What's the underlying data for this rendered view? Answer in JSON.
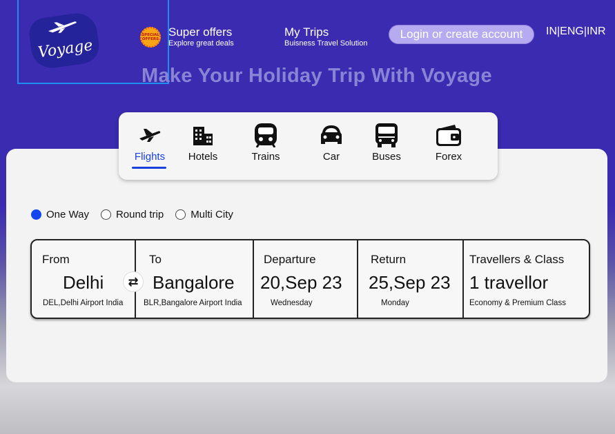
{
  "brand": {
    "logo_text": "Voyage",
    "badge_text": "SPECIAL OFFERS"
  },
  "nav": {
    "offers": {
      "title": "Super offers",
      "subtitle": "Explore great deals"
    },
    "trips": {
      "title": "My Trips",
      "subtitle": "Buisness Travel Solution"
    },
    "login_label": "Login or create account",
    "locale": "IN|ENG|INR"
  },
  "hero": {
    "title": "Make Your Holiday Trip With Voyage"
  },
  "tabs": [
    {
      "label": "Flights",
      "icon": "airplane-icon",
      "active": true
    },
    {
      "label": "Hotels",
      "icon": "hotel-icon"
    },
    {
      "label": "Trains",
      "icon": "train-icon"
    },
    {
      "label": "Car",
      "icon": "car-icon"
    },
    {
      "label": "Buses",
      "icon": "bus-icon"
    },
    {
      "label": "Forex",
      "icon": "wallet-icon"
    }
  ],
  "trip_types": [
    {
      "label": "One Way",
      "selected": true
    },
    {
      "label": "Round trip",
      "selected": false
    },
    {
      "label": "Multi City",
      "selected": false
    }
  ],
  "search": {
    "from": {
      "label": "From",
      "city": "Delhi",
      "airport": "DEL,Delhi Airport India"
    },
    "to": {
      "label": "To",
      "city": "Bangalore",
      "airport": "BLR,Bangalore Airport India"
    },
    "departure": {
      "label": "Departure",
      "date": "20,Sep 23",
      "day": "Wednesday"
    },
    "return": {
      "label": "Return",
      "date": "25,Sep 23",
      "day": "Monday"
    },
    "travellers": {
      "label": "Travellers & Class",
      "count": "1 travellor",
      "class": "Economy & Premium Class"
    }
  },
  "colors": {
    "header_bg": "#3a2bb0",
    "accent": "#1840e0",
    "login_bg": "#b6aaf0"
  }
}
